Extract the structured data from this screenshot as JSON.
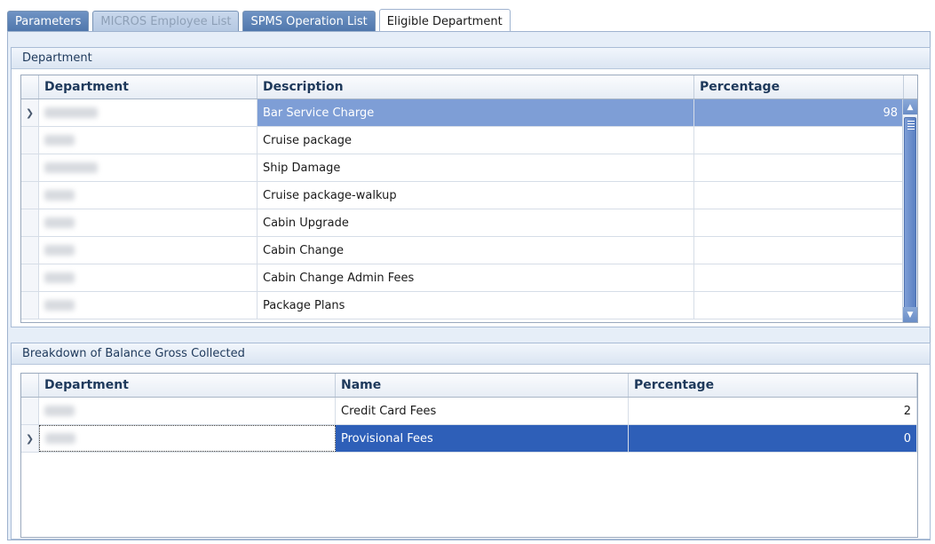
{
  "tabs": [
    {
      "label": "Parameters",
      "state": "normal"
    },
    {
      "label": "MICROS Employee List",
      "state": "disabled"
    },
    {
      "label": "SPMS Operation List",
      "state": "normal"
    },
    {
      "label": "Eligible Department",
      "state": "active"
    }
  ],
  "department_group": {
    "title": "Department",
    "columns": {
      "department": "Department",
      "description": "Description",
      "percentage": "Percentage"
    },
    "rows": [
      {
        "description": "Bar Service Charge",
        "percentage": "98",
        "selected": true
      },
      {
        "description": "Cruise package",
        "percentage": ""
      },
      {
        "description": "Ship Damage",
        "percentage": ""
      },
      {
        "description": "Cruise package-walkup",
        "percentage": ""
      },
      {
        "description": "Cabin Upgrade",
        "percentage": ""
      },
      {
        "description": "Cabin Change",
        "percentage": ""
      },
      {
        "description": "Cabin Change Admin Fees",
        "percentage": ""
      },
      {
        "description": "Package Plans",
        "percentage": ""
      }
    ]
  },
  "breakdown_group": {
    "title": "Breakdown of Balance Gross Collected",
    "columns": {
      "department": "Department",
      "name": "Name",
      "percentage": "Percentage"
    },
    "rows": [
      {
        "name": "Credit Card Fees",
        "percentage": "2"
      },
      {
        "name": "Provisional Fees",
        "percentage": "0",
        "selected": true
      }
    ]
  },
  "colors": {
    "selected_row_light": "#7e9ed6",
    "selected_row_dark": "#2e5fb8",
    "tab_blue": "#5b81b6"
  },
  "icons": {
    "row_indicator": "chevron-right-icon",
    "scroll_up": "arrow-up-icon",
    "scroll_down": "arrow-down-icon"
  }
}
